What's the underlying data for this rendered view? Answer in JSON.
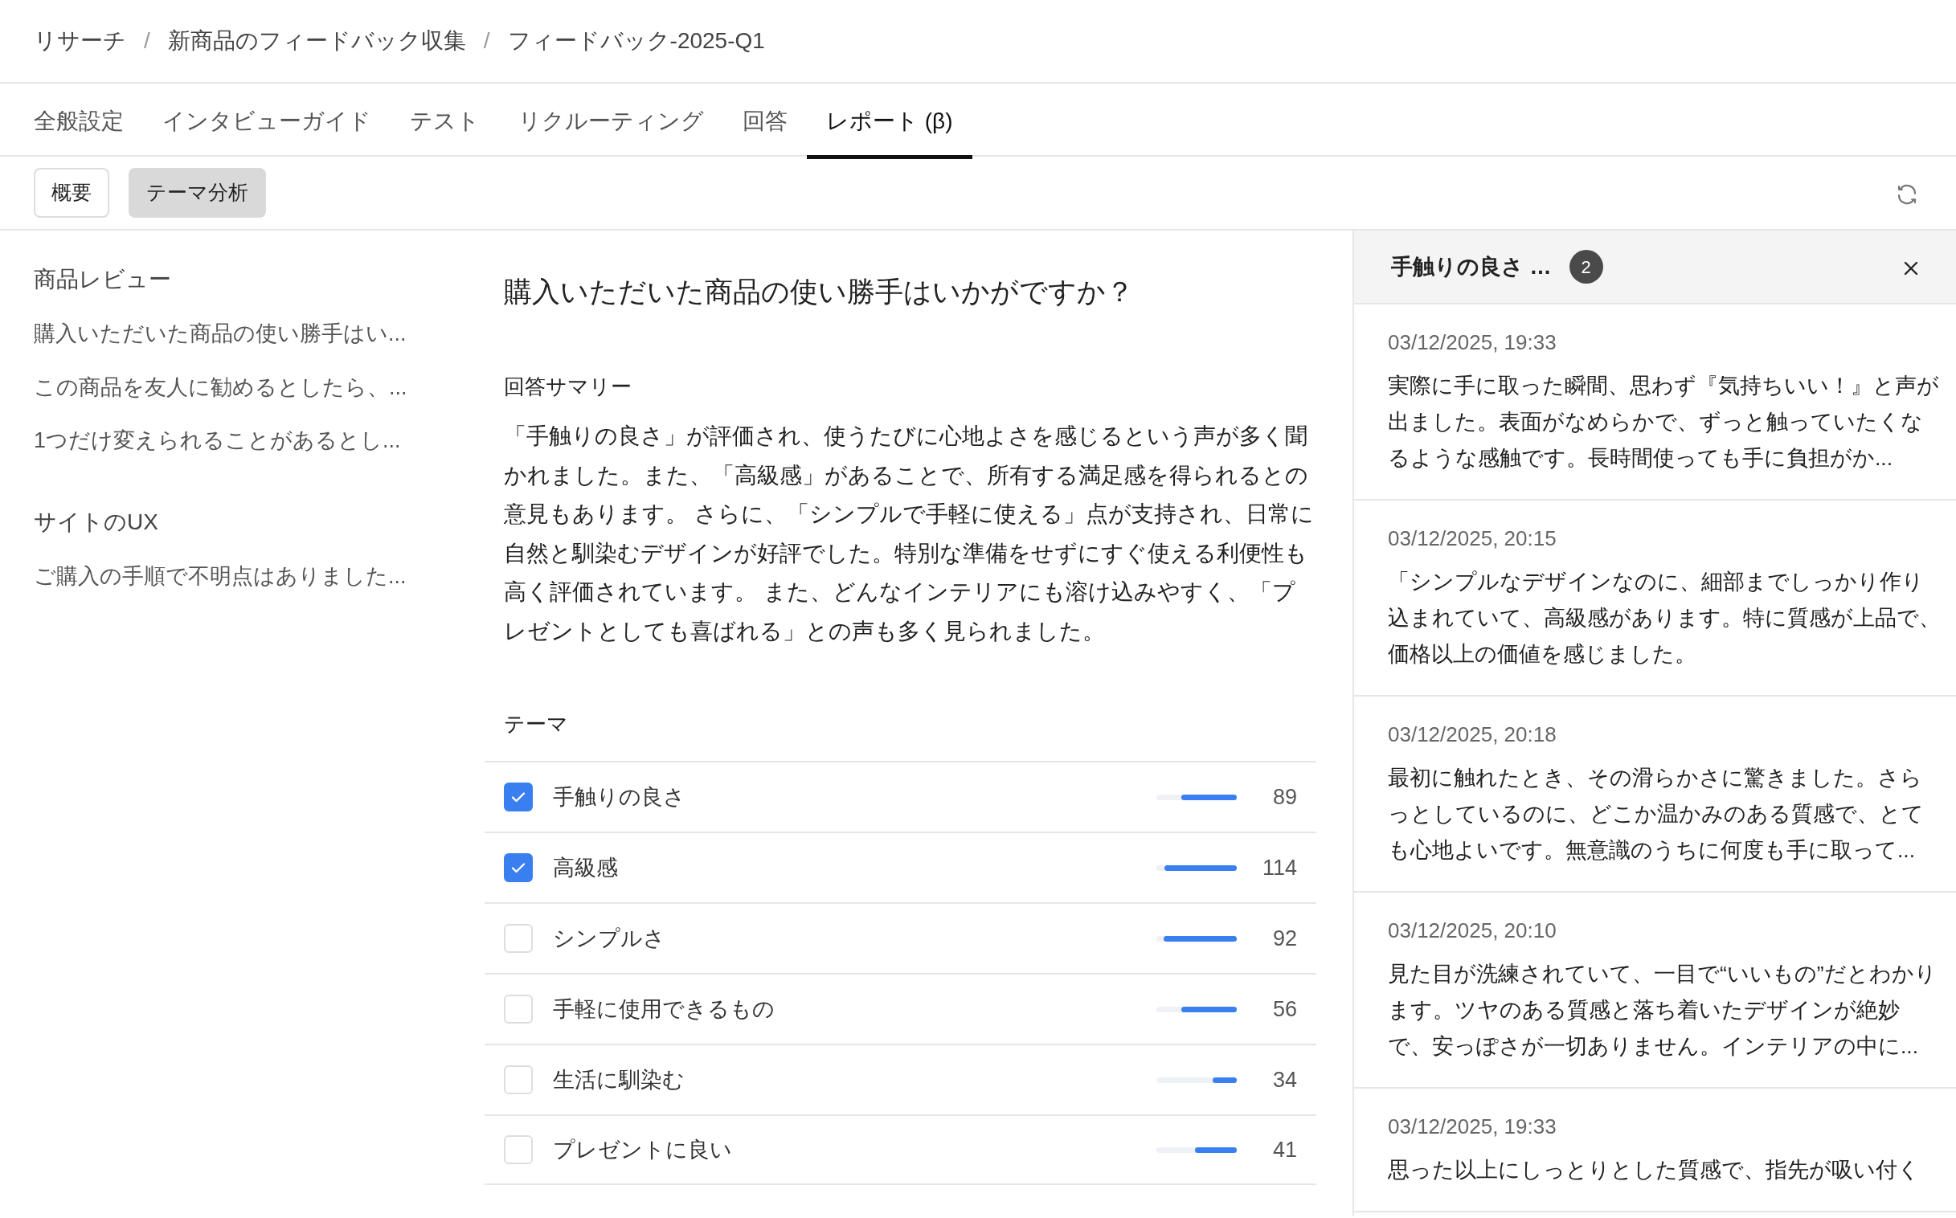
{
  "breadcrumb": [
    "リサーチ",
    "新商品のフィードバック収集",
    "フィードバック-2025-Q1"
  ],
  "breadcrumb_separators": [
    "/",
    "/"
  ],
  "tabs": [
    {
      "label": "全般設定",
      "selected": false
    },
    {
      "label": "インタビューガイド",
      "selected": false
    },
    {
      "label": "テスト",
      "selected": false
    },
    {
      "label": "リクルーティング",
      "selected": false
    },
    {
      "label": "回答",
      "selected": false
    },
    {
      "label": "レポート (β)",
      "selected": true
    }
  ],
  "subtabs": [
    {
      "label": "概要",
      "selected": false
    },
    {
      "label": "テーマ分析",
      "selected": true
    }
  ],
  "sidebar": {
    "groups": [
      {
        "title": "商品レビュー",
        "items": [
          {
            "label": "購入いただいた商品の使い勝手はい...",
            "selected": false
          },
          {
            "label": "この商品を友人に勧めるとしたら、...",
            "selected": false
          },
          {
            "label": "1つだけ変えられることがあるとし...",
            "selected": false
          }
        ]
      },
      {
        "title": "サイトのUX",
        "items": [
          {
            "label": "ご購入の手順で不明点はありました...",
            "selected": false
          }
        ]
      }
    ]
  },
  "question": "購入いただいた商品の使い勝手はいかがですか？",
  "summary": {
    "heading": "回答サマリー",
    "text": "「手触りの良さ」が評価され、使うたびに心地よさを感じるという声が多く聞かれました。また、「高級感」があることで、所有する満足感を得られるとの意見もあります。 さらに、「シンプルで手軽に使える」点が支持され、日常に自然と馴染むデザインが好評でした。特別な準備をせずにすぐ使える利便性も高く評価されています。 また、どんなインテリアにも溶け込みやすく、「プレゼントとしても喜ばれる」との声も多く見られました。"
  },
  "themes": {
    "heading": "テーマ",
    "items": [
      {
        "label": "手触りの良さ",
        "checked": true,
        "level": 0.69,
        "count": "89"
      },
      {
        "label": "高級感",
        "checked": true,
        "level": 0.9,
        "count": "114"
      },
      {
        "label": "シンプルさ",
        "checked": false,
        "level": 0.91,
        "count": "92"
      },
      {
        "label": "手軽に使用できるもの",
        "checked": false,
        "level": 0.69,
        "count": "56"
      },
      {
        "label": "生活に馴染む",
        "checked": false,
        "level": 0.3,
        "count": "34"
      },
      {
        "label": "プレゼントに良い",
        "checked": false,
        "level": 0.52,
        "count": "41"
      }
    ]
  },
  "panel": {
    "title": "手触りの良さ …",
    "badge": "2",
    "comments": [
      {
        "time": "03/12/2025, 19:33",
        "text": "実際に手に取った瞬間、思わず『気持ちいい！』と声が出ました。表面がなめらかで、ずっと触っていたくなるような感触です。長時間使っても手に負担がか..."
      },
      {
        "time": "03/12/2025, 20:15",
        "text": "「シンプルなデザインなのに、細部までしっかり作り込まれていて、高級感があります。特に質感が上品で、価格以上の価値を感じました。"
      },
      {
        "time": "03/12/2025, 20:18",
        "text": "最初に触れたとき、その滑らかさに驚きました。さらっとしているのに、どこか温かみのある質感で、とても心地よいです。無意識のうちに何度も手に取って..."
      },
      {
        "time": "03/12/2025, 20:10",
        "text": "見た目が洗練されていて、一目で“いいもの”だとわかります。ツヤのある質感と落ち着いたデザインが絶妙で、安っぽさが一切ありません。インテリアの中に..."
      },
      {
        "time": "03/12/2025, 19:33",
        "text": "思った以上にしっとりとした質感で、指先が吸い付く"
      }
    ]
  }
}
